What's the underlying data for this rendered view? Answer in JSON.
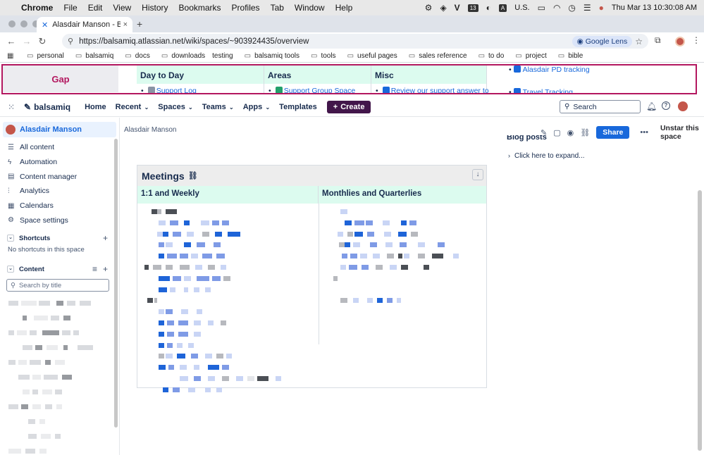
{
  "menubar": {
    "app": "Chrome",
    "items": [
      "File",
      "Edit",
      "View",
      "History",
      "Bookmarks",
      "Profiles",
      "Tab",
      "Window",
      "Help"
    ],
    "status_icons": [
      "gear-icon",
      "dropbox-icon",
      "v-icon"
    ],
    "badge": "13",
    "input_source_key": "A",
    "input_source": "U.S.",
    "clock": "Thu Mar 13  10:30:08 AM"
  },
  "browser": {
    "tab_title": "Alasdair Manson - Balsamiq",
    "url": "https://balsamiq.atlassian.net/wiki/spaces/~903924435/overview",
    "lens_label": "Google Lens",
    "bookmarks": [
      {
        "label": "personal",
        "folder": true
      },
      {
        "label": "balsamiq",
        "folder": true
      },
      {
        "label": "docs",
        "folder": true
      },
      {
        "label": "downloads",
        "folder": true
      },
      {
        "label": "testing",
        "folder": false
      },
      {
        "label": "balsamiq tools",
        "folder": true
      },
      {
        "label": "tools",
        "folder": true
      },
      {
        "label": "useful pages",
        "folder": true
      },
      {
        "label": "sales reference",
        "folder": true
      },
      {
        "label": "to do",
        "folder": true
      },
      {
        "label": "project",
        "folder": true
      },
      {
        "label": "bible",
        "folder": true
      }
    ]
  },
  "gap": {
    "label": "Gap",
    "columns": [
      {
        "header": "Day to Day",
        "link": "Support Log"
      },
      {
        "header": "Areas",
        "link": "Support Group Space"
      },
      {
        "header": "Misc",
        "link": "Review our support answer to"
      }
    ],
    "side_links": [
      "Alasdair PD tracking",
      "Travel Tracking"
    ]
  },
  "topnav": {
    "brand": "balsamiq",
    "items": [
      {
        "label": "Home",
        "dropdown": false
      },
      {
        "label": "Recent",
        "dropdown": true
      },
      {
        "label": "Spaces",
        "dropdown": true
      },
      {
        "label": "Teams",
        "dropdown": true
      },
      {
        "label": "Apps",
        "dropdown": true
      },
      {
        "label": "Templates",
        "dropdown": false
      }
    ],
    "create_label": "Create",
    "search_placeholder": "Search"
  },
  "sidebar": {
    "space_name": "Alasdair Manson",
    "items": [
      {
        "label": "All content",
        "icon": "list-icon"
      },
      {
        "label": "Automation",
        "icon": "bolt-icon"
      },
      {
        "label": "Content manager",
        "icon": "folder-icon"
      },
      {
        "label": "Analytics",
        "icon": "chart-icon"
      },
      {
        "label": "Calendars",
        "icon": "calendar-icon"
      },
      {
        "label": "Space settings",
        "icon": "gear-icon"
      }
    ],
    "shortcuts_title": "Shortcuts",
    "shortcuts_empty": "No shortcuts in this space",
    "content_title": "Content",
    "content_search_placeholder": "Search by title"
  },
  "main": {
    "breadcrumb": "Alasdair Manson",
    "share_label": "Share",
    "unstar_label": "Unstar this space",
    "blog_heading": "Blog posts",
    "expand_label": "Click here to expand...",
    "meetings_title": "Meetings",
    "col1": "1:1 and Weekly",
    "col2": "Monthlies and Quarterlies"
  },
  "colors": {
    "accent": "#1868db",
    "create_button": "#42164a",
    "gap_border": "#b3175f",
    "table_header": "#dcfbef"
  }
}
